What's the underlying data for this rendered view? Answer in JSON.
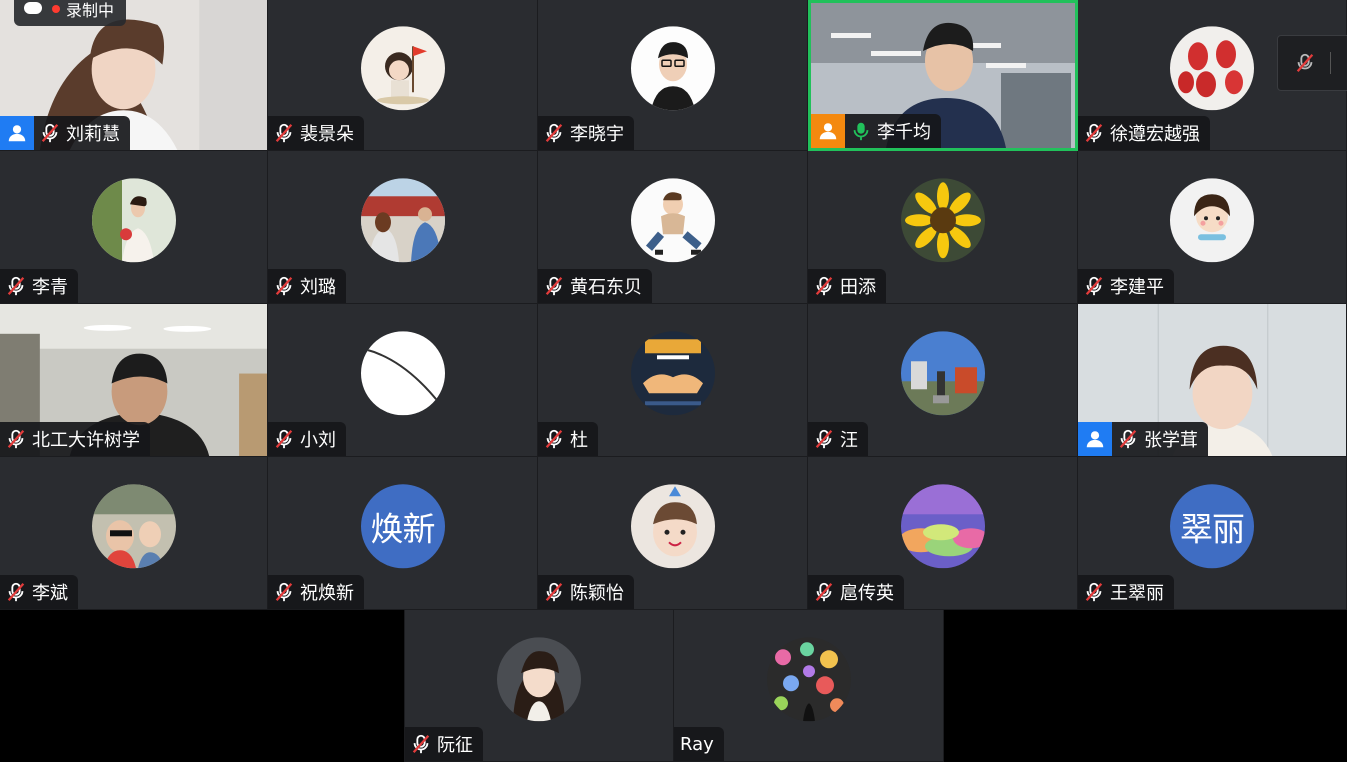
{
  "recording": {
    "label": "录制中"
  },
  "participants": [
    {
      "name": "刘莉慧"
    },
    {
      "name": "裴景朵"
    },
    {
      "name": "李晓宇"
    },
    {
      "name": "李千均"
    },
    {
      "name": "徐遵宏越强"
    },
    {
      "name": "李青"
    },
    {
      "name": "刘璐"
    },
    {
      "name": "黄石东贝"
    },
    {
      "name": "田添"
    },
    {
      "name": "李建平"
    },
    {
      "name": "北工大许树学"
    },
    {
      "name": "小刘"
    },
    {
      "name": "杜"
    },
    {
      "name": "汪"
    },
    {
      "name": "张学茸"
    },
    {
      "name": "李斌"
    },
    {
      "name": "祝焕新",
      "avatar_text": "焕新"
    },
    {
      "name": "陈颖怡"
    },
    {
      "name": "扈传英"
    },
    {
      "name": "王翠丽",
      "avatar_text": "翠丽"
    },
    {
      "name": "阮征"
    },
    {
      "name": "Ray"
    }
  ],
  "colors": {
    "active_speaker_border": "#21c15b",
    "host_badge": "#1f7cf3",
    "cohost_badge": "#f4890f",
    "text_avatar_bg": "#3f6dc3",
    "muted_mic": "#e23b3b"
  }
}
